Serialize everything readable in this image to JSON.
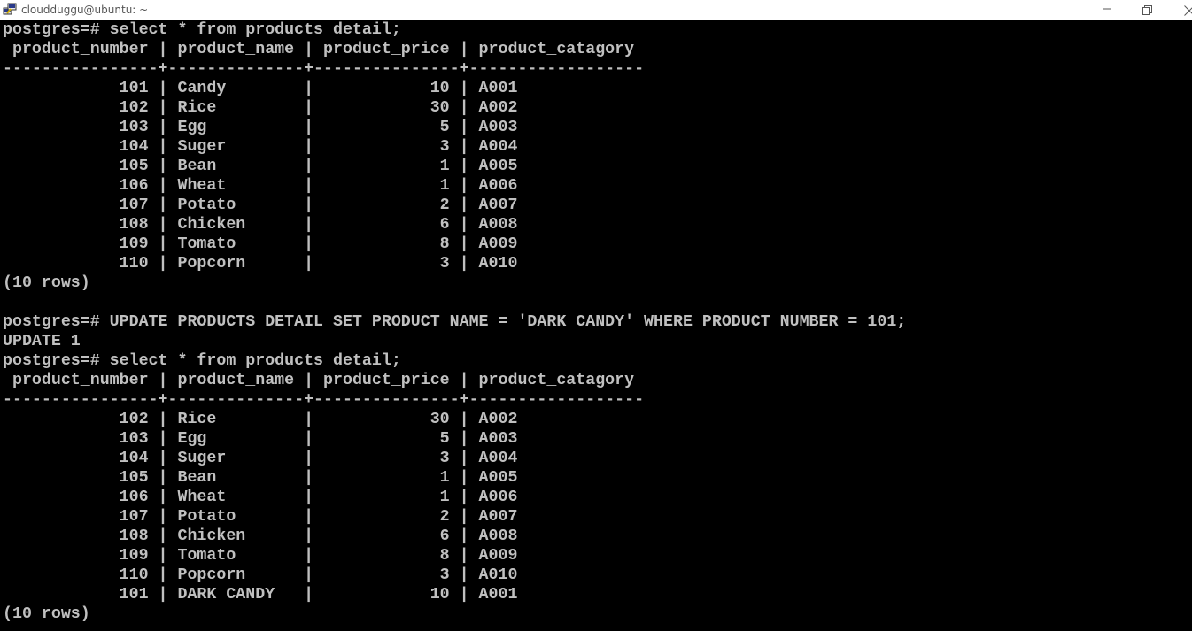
{
  "window": {
    "title": "cloudduggu@ubuntu: ~",
    "icons": {
      "app": "putty-icon",
      "minimize": "minimize-icon",
      "restore": "restore-icon",
      "close": "close-icon"
    }
  },
  "colors": {
    "terminal_bg": "#000000",
    "terminal_fg": "#c0c0c0",
    "titlebar_bg": "#ffffff"
  },
  "terminal": {
    "lines": [
      "postgres=# select * from products_detail;",
      " product_number | product_name | product_price | product_catagory",
      "----------------+--------------+---------------+------------------",
      "            101 | Candy        |            10 | A001",
      "            102 | Rice         |            30 | A002",
      "            103 | Egg          |             5 | A003",
      "            104 | Suger        |             3 | A004",
      "            105 | Bean         |             1 | A005",
      "            106 | Wheat        |             1 | A006",
      "            107 | Potato       |             2 | A007",
      "            108 | Chicken      |             6 | A008",
      "            109 | Tomato       |             8 | A009",
      "            110 | Popcorn      |             3 | A010",
      "(10 rows)",
      "",
      "postgres=# UPDATE PRODUCTS_DETAIL SET PRODUCT_NAME = 'DARK CANDY' WHERE PRODUCT_NUMBER = 101;",
      "UPDATE 1",
      "postgres=# select * from products_detail;",
      " product_number | product_name | product_price | product_catagory",
      "----------------+--------------+---------------+------------------",
      "            102 | Rice         |            30 | A002",
      "            103 | Egg          |             5 | A003",
      "            104 | Suger        |             3 | A004",
      "            105 | Bean         |             1 | A005",
      "            106 | Wheat        |             1 | A006",
      "            107 | Potato       |             2 | A007",
      "            108 | Chicken      |             6 | A008",
      "            109 | Tomato       |             8 | A009",
      "            110 | Popcorn      |             3 | A010",
      "            101 | DARK CANDY   |            10 | A001",
      "(10 rows)"
    ]
  }
}
